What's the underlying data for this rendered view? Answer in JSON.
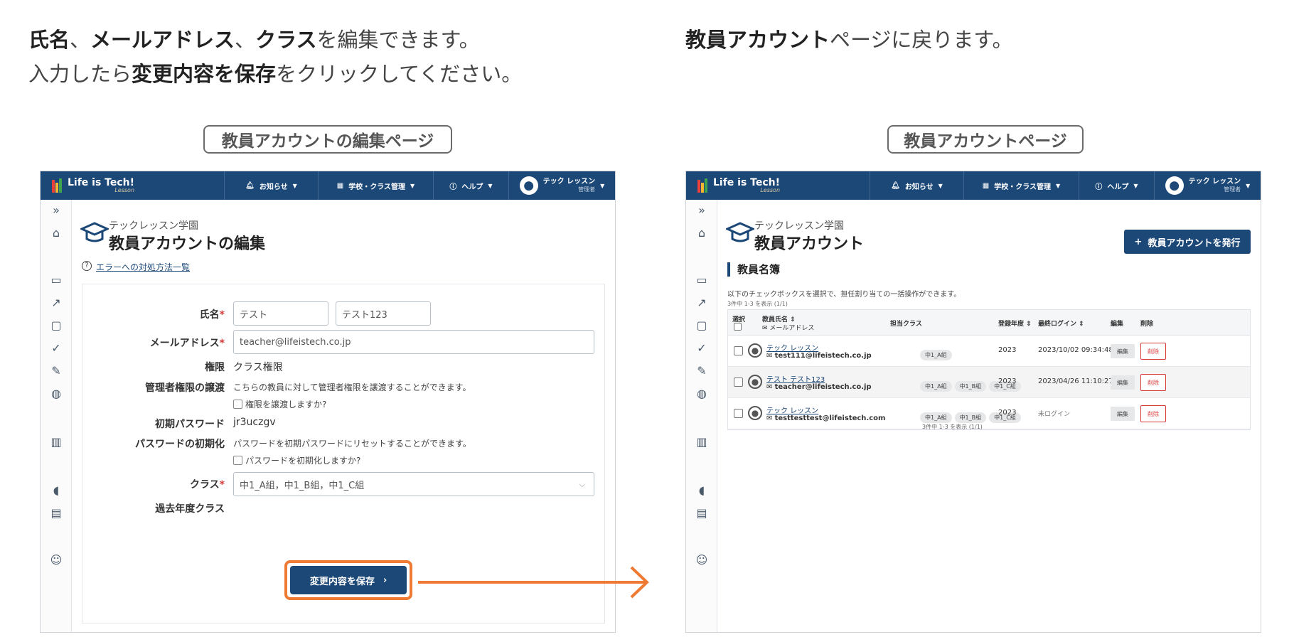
{
  "intro_left": {
    "line1_b1": "氏名",
    "line1_t1": "、",
    "line1_b2": "メールアドレス",
    "line1_t2": "、",
    "line1_b3": "クラス",
    "line1_t3": "を編集できます。",
    "line2_t1": "入力したら",
    "line2_b1": "変更内容を保存",
    "line2_t2": "をクリックしてください。"
  },
  "intro_right": {
    "b1": "教員アカウント",
    "t1": "ページに戻ります。"
  },
  "pill_left": "教員アカウントの編集ページ",
  "pill_right": "教員アカウントページ",
  "topbar": {
    "logo": "Life is Tech!",
    "logo_sub": "Lesson",
    "notice": "お知らせ",
    "school_mgmt": "学校・クラス管理",
    "help": "ヘルプ",
    "user_name": "テック レッスン",
    "user_role": "管理者"
  },
  "edit_page": {
    "school": "テックレッスン学園",
    "title": "教員アカウントの編集",
    "error_link": "エラーへの対処方法一覧",
    "labels": {
      "name": "氏名",
      "email": "メールアドレス",
      "role": "権限",
      "transfer": "管理者権限の譲渡",
      "initial_pw": "初期パスワード",
      "pw_reset": "パスワードの初期化",
      "class": "クラス",
      "past_class": "過去年度クラス"
    },
    "required_mark": "*",
    "last_name": "テスト",
    "first_name": "テスト123",
    "email": "teacher@lifeistech.co.jp",
    "role_value": "クラス権限",
    "transfer_note": "こちらの教員に対して管理者権限を譲渡することができます。",
    "transfer_check": "権限を譲渡しますか?",
    "initial_pw_value": "jr3uczgv",
    "pw_reset_note": "パスワードを初期パスワードにリセットすることができます。",
    "pw_reset_check": "パスワードを初期化しますか?",
    "class_value": "中1_A組，中1_B組，中1_C組",
    "save_button": "変更内容を保存"
  },
  "list_page": {
    "school": "テックレッスン学園",
    "title": "教員アカウント",
    "issue_button": "教員アカウントを発行",
    "section_title": "教員名簿",
    "description": "以下のチェックボックスを選択で、担任割り当ての一括操作ができます。",
    "count": "3件中 1-3 を表示 (1/1)",
    "headers": {
      "select": "選択",
      "name": "教員氏名",
      "email": "メールアドレス",
      "classes": "担当クラス",
      "year": "登録年度",
      "last_login": "最終ログイン",
      "edit": "編集",
      "delete": "削除"
    },
    "rows": [
      {
        "name": "テック レッスン",
        "email": "test111@lifeistech.co.jp",
        "classes": [
          "中1_A組"
        ],
        "year": "2023",
        "last_login": "2023/10/02 09:34:48",
        "edit": "編集",
        "delete": "削除"
      },
      {
        "name": "テスト テスト123",
        "email": "teacher@lifeistech.co.jp",
        "classes": [
          "中1_A組",
          "中1_B組",
          "中1_C組"
        ],
        "year": "2023",
        "last_login": "2023/04/26 11:10:27",
        "edit": "編集",
        "delete": "削除"
      },
      {
        "name": "テック レッスン",
        "email": "testtesttest@lifeistech.com",
        "classes": [
          "中1_A組",
          "中1_B組",
          "中1_C組"
        ],
        "year": "2023",
        "last_login": "未ログイン",
        "edit": "編集",
        "delete": "削除"
      }
    ]
  },
  "colors": {
    "navy": "#1c4878",
    "highlight_orange": "#ee7a34",
    "required_red": "#d83a3a"
  }
}
